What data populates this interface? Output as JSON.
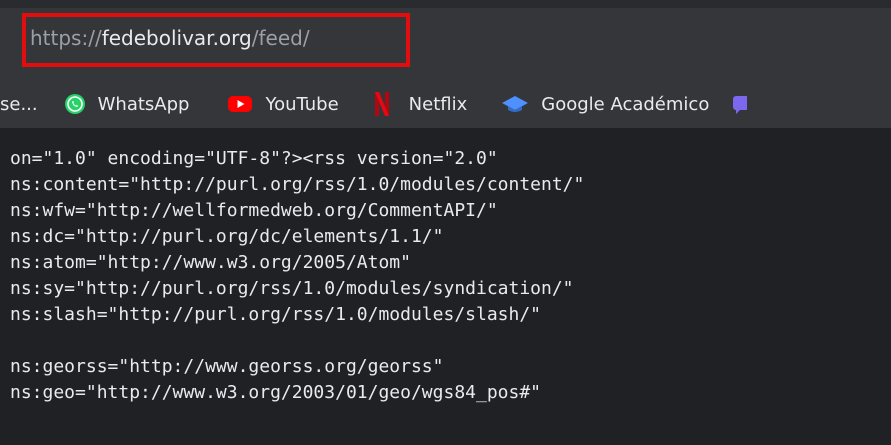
{
  "address_bar": {
    "scheme": "https://",
    "host": "fedebolivar.org",
    "path": "/feed/"
  },
  "bookmarks": {
    "truncated_label": "se...",
    "whatsapp": {
      "label": "WhatsApp",
      "icon": "whatsapp-icon"
    },
    "youtube": {
      "label": "YouTube",
      "icon": "youtube-icon"
    },
    "netflix": {
      "label": "Netflix",
      "icon": "netflix-icon"
    },
    "google_scholar": {
      "label": "Google Académico",
      "icon": "graduation-cap-icon"
    },
    "cut_off_item": {
      "icon": "chat-bubble-icon"
    }
  },
  "source_lines": [
    "on=\"1.0\" encoding=\"UTF-8\"?><rss version=\"2.0\"",
    "ns:content=\"http://purl.org/rss/1.0/modules/content/\"",
    "ns:wfw=\"http://wellformedweb.org/CommentAPI/\"",
    "ns:dc=\"http://purl.org/dc/elements/1.1/\"",
    "ns:atom=\"http://www.w3.org/2005/Atom\"",
    "ns:sy=\"http://purl.org/rss/1.0/modules/syndication/\"",
    "ns:slash=\"http://purl.org/rss/1.0/modules/slash/\"",
    "",
    "ns:georss=\"http://www.georss.org/georss\"",
    "ns:geo=\"http://www.w3.org/2003/01/geo/wgs84_pos#\""
  ],
  "colors": {
    "highlight_border": "#e10e0e",
    "whatsapp": "#25d366",
    "youtube": "#ff0000",
    "netflix": "#e50914",
    "scholar": "#4d90fe",
    "cut_off_icon": "#7b68ee"
  }
}
